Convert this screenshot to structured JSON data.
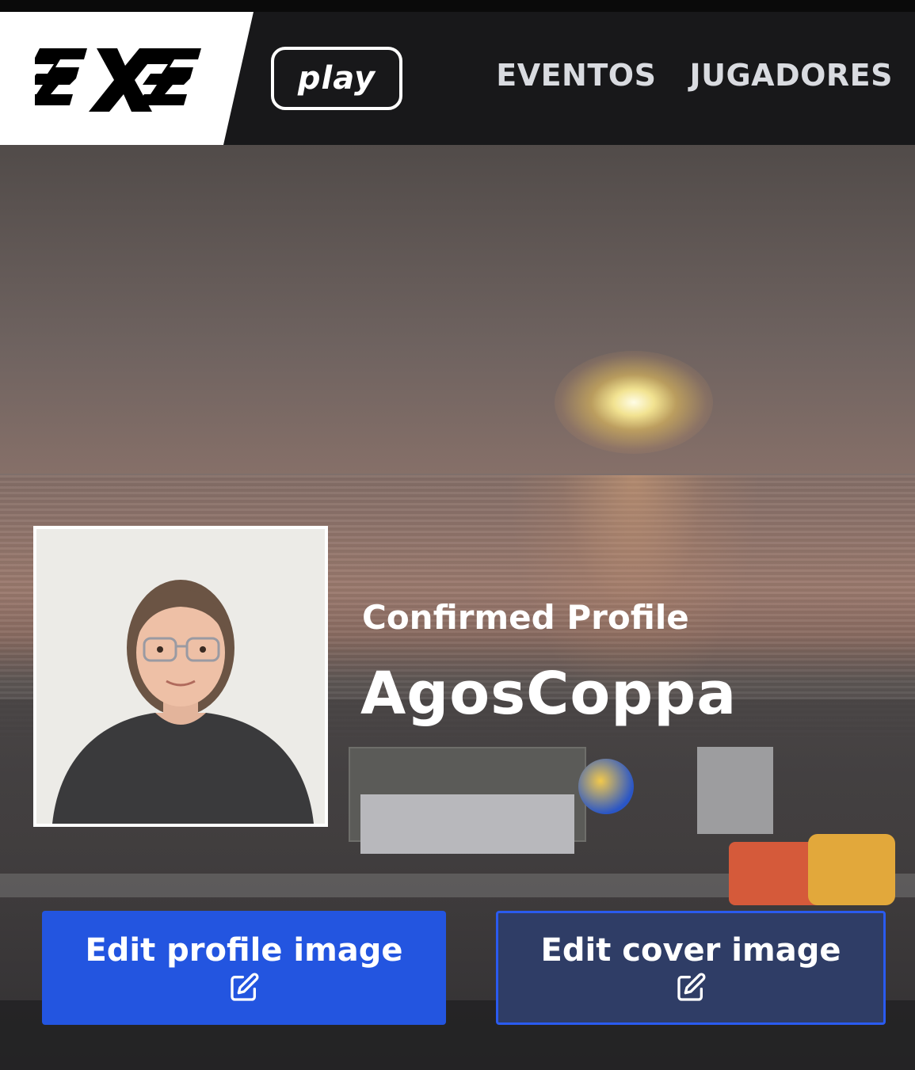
{
  "brand": {
    "logo_icon": "3x3-logo-icon",
    "play_label": "play"
  },
  "nav": {
    "items": [
      {
        "label": "EVENTOS"
      },
      {
        "label": "JUGADORES"
      }
    ]
  },
  "profile": {
    "status": "Confirmed Profile",
    "username": "AgosCoppa"
  },
  "actions": {
    "edit_profile_image": "Edit profile image",
    "edit_cover_image": "Edit cover image",
    "edit_icon": "pencil-square-icon"
  },
  "colors": {
    "nav_bg": "#18181a",
    "primary_button": "#2355e0",
    "secondary_button": "#2f3d66",
    "secondary_border": "#2a5bf0"
  }
}
